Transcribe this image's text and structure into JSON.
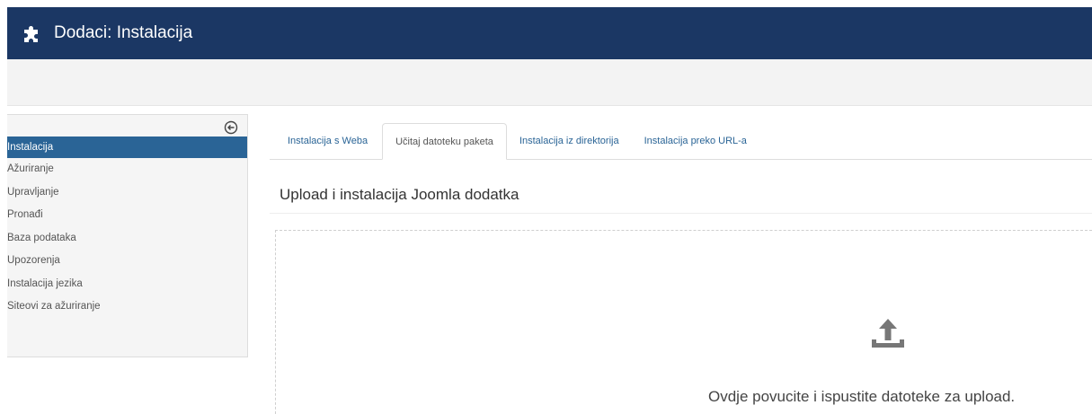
{
  "header": {
    "icon": "puzzle-icon",
    "title": "Dodaci: Instalacija"
  },
  "sidebar": {
    "collapse_icon": "circle-arrow-left-icon",
    "items": [
      {
        "label": "Instalacija",
        "active": true
      },
      {
        "label": "Ažuriranje",
        "active": false
      },
      {
        "label": "Upravljanje",
        "active": false
      },
      {
        "label": "Pronađi",
        "active": false
      },
      {
        "label": "Baza podataka",
        "active": false
      },
      {
        "label": "Upozorenja",
        "active": false
      },
      {
        "label": "Instalacija jezika",
        "active": false
      },
      {
        "label": "Siteovi za ažuriranje",
        "active": false
      }
    ]
  },
  "tabs": [
    {
      "label": "Instalacija s Weba",
      "active": false
    },
    {
      "label": "Učitaj datoteku paketa",
      "active": true
    },
    {
      "label": "Instalacija iz direktorija",
      "active": false
    },
    {
      "label": "Instalacija preko URL-a",
      "active": false
    }
  ],
  "main": {
    "section_title": "Upload i instalacija Joomla dodatka",
    "dropzone": {
      "icon": "upload-icon",
      "text": "Ovdje povucite i ispustite datoteke za upload."
    }
  },
  "colors": {
    "header_bg": "#1b3764",
    "active_item_bg": "#2a6496",
    "link": "#2a6496"
  }
}
